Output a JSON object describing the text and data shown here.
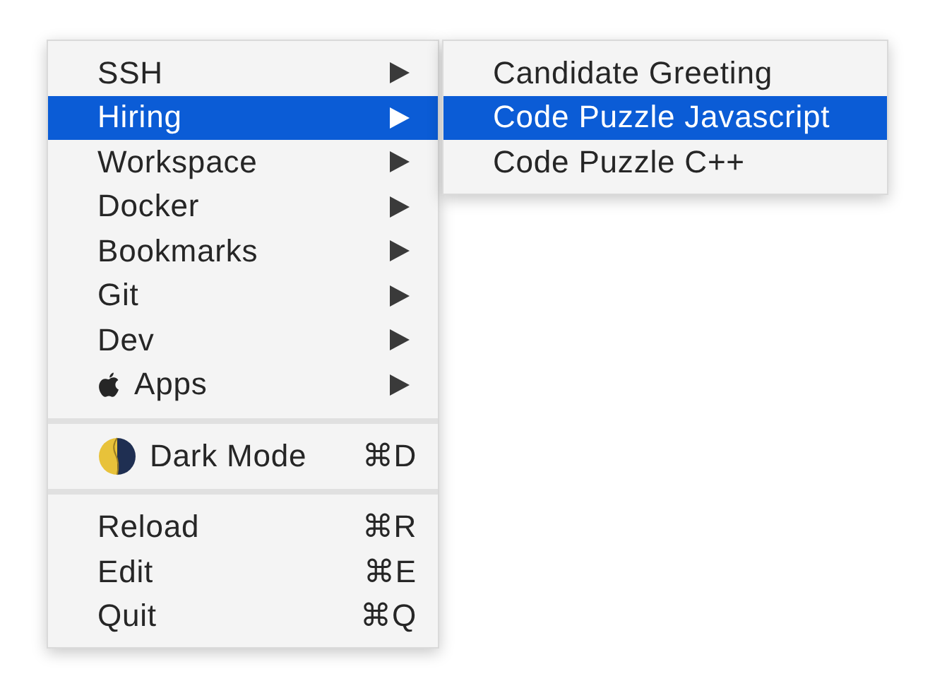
{
  "menu": {
    "sections": [
      {
        "items": [
          {
            "label": "SSH",
            "kind": "submenu",
            "selected": false
          },
          {
            "label": "Hiring",
            "kind": "submenu",
            "selected": true,
            "submenu": {
              "items": [
                {
                  "label": "Candidate Greeting",
                  "kind": "command",
                  "selected": false
                },
                {
                  "label": "Code Puzzle Javascript",
                  "kind": "command",
                  "selected": true
                },
                {
                  "label": "Code Puzzle C++",
                  "kind": "command",
                  "selected": false
                }
              ]
            }
          },
          {
            "label": "Workspace",
            "kind": "submenu",
            "selected": false
          },
          {
            "label": "Docker",
            "kind": "submenu",
            "selected": false
          },
          {
            "label": "Bookmarks",
            "kind": "submenu",
            "selected": false
          },
          {
            "label": "Git",
            "kind": "submenu",
            "selected": false
          },
          {
            "label": "Dev",
            "kind": "submenu",
            "selected": false
          },
          {
            "label": "Apps",
            "kind": "apps",
            "selected": false
          }
        ]
      },
      {
        "items": [
          {
            "label": "Dark Mode",
            "kind": "appearance",
            "shortcut": "⌘D",
            "selected": false
          }
        ]
      },
      {
        "items": [
          {
            "label": "Reload",
            "kind": "command",
            "shortcut": "⌘R",
            "selected": false
          },
          {
            "label": "Edit",
            "kind": "command",
            "shortcut": "⌘E",
            "selected": false
          },
          {
            "label": "Quit",
            "kind": "command",
            "shortcut": "⌘Q",
            "selected": false
          }
        ]
      }
    ]
  }
}
